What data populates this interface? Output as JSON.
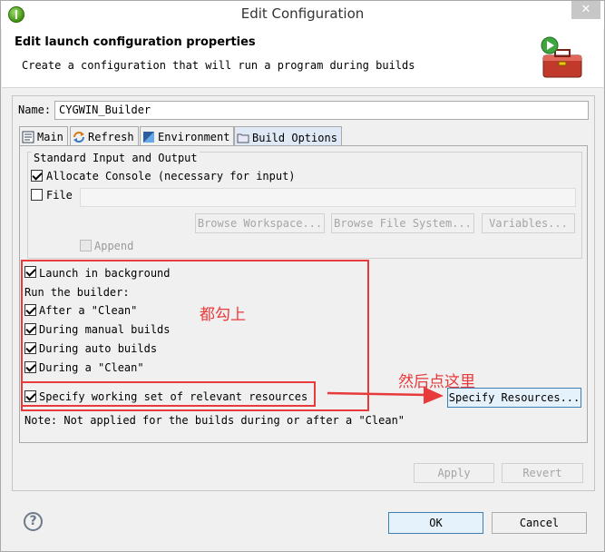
{
  "window": {
    "title": "Edit Configuration",
    "close_label": "✕"
  },
  "banner": {
    "title": "Edit launch configuration properties",
    "description": "Create a configuration that will run a program during builds"
  },
  "name": {
    "label": "Name:",
    "value": "CYGWIN_Builder"
  },
  "tabs": [
    {
      "label": "Main"
    },
    {
      "label": "Refresh"
    },
    {
      "label": "Environment"
    },
    {
      "label": "Build Options"
    }
  ],
  "standard_io": {
    "legend": "Standard Input and Output",
    "allocate_console": {
      "label": "Allocate Console (necessary for input)",
      "checked": true
    },
    "file": {
      "label": "File",
      "value": "",
      "checked": false
    },
    "browse_workspace": "Browse Workspace...",
    "browse_file_system": "Browse File System...",
    "variables": "Variables...",
    "append": {
      "label": "Append",
      "checked": false
    }
  },
  "launch_in_background": {
    "label": "Launch in background",
    "checked": true
  },
  "run_the_builder": "Run the builder:",
  "builder_options": [
    {
      "label": "After a \"Clean\"",
      "checked": true
    },
    {
      "label": "During manual builds",
      "checked": true
    },
    {
      "label": "During auto builds",
      "checked": true
    },
    {
      "label": "During a \"Clean\"",
      "checked": true
    }
  ],
  "specify_working_set": {
    "label": "Specify working set of relevant resources",
    "checked": true
  },
  "specify_resources_button": "Specify Resources...",
  "note": "Note: Not applied for the builds during or after a \"Clean\"",
  "annotations": {
    "check_all": "都勾上",
    "click_here": "然后点这里",
    "color": "#e8393b"
  },
  "footer": {
    "apply": "Apply",
    "revert": "Revert",
    "ok": "OK",
    "cancel": "Cancel",
    "help": "?"
  },
  "icons": {
    "app": "eclipse-icon",
    "banner": "toolbox-run-icon",
    "help": "help-icon"
  }
}
